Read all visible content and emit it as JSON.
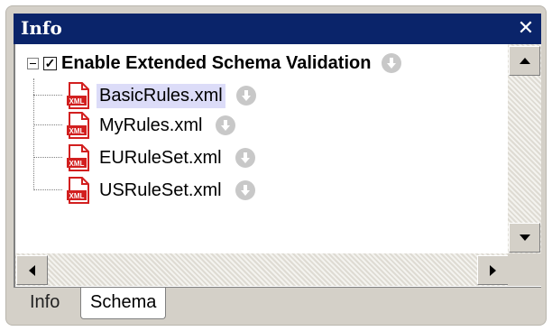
{
  "window": {
    "title": "Info"
  },
  "tree": {
    "root": {
      "label": "Enable Extended Schema Validation",
      "checked": true
    },
    "files": [
      {
        "label": "BasicRules.xml",
        "selected": true
      },
      {
        "label": "MyRules.xml",
        "selected": false
      },
      {
        "label": "EURuleSet.xml",
        "selected": false
      },
      {
        "label": "USRuleSet.xml",
        "selected": false
      }
    ],
    "file_icon": "xml-file-icon",
    "action_icon": "download-icon"
  },
  "tabs": [
    {
      "label": "Info",
      "active": false
    },
    {
      "label": "Schema",
      "active": true
    }
  ],
  "colors": {
    "titlebar": "#0a246a",
    "selection": "#dcdcf8",
    "xml_icon_red": "#d21f1f"
  }
}
